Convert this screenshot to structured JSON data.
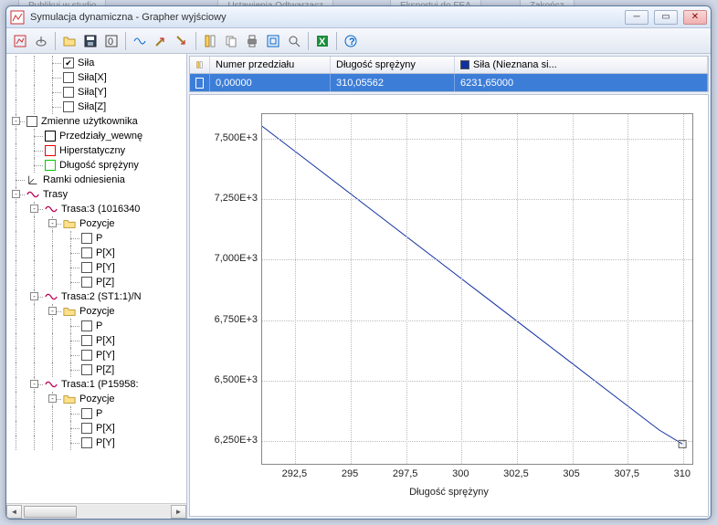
{
  "bg_tabs": [
    "Publikuj w studio",
    "Ustawienia Odtwarzacz",
    "Eksportuj do FEA",
    "Zakończ"
  ],
  "window": {
    "title": "Symulacja dynamiczna - Grapher wyjściowy"
  },
  "tree": {
    "items": [
      {
        "depth": 3,
        "check": "checked",
        "label": "Siła"
      },
      {
        "depth": 3,
        "check": "unchecked",
        "label": "Siła[X]"
      },
      {
        "depth": 3,
        "check": "unchecked",
        "label": "Siła[Y]"
      },
      {
        "depth": 3,
        "check": "unchecked",
        "label": "Siła[Z]"
      },
      {
        "depth": 1,
        "expander": "-",
        "check": "unchecked",
        "label": "Zmienne użytkownika"
      },
      {
        "depth": 2,
        "check": "unchecked",
        "color": "#000",
        "label": "Przedziały_wewnę"
      },
      {
        "depth": 2,
        "check": "unchecked",
        "color": "#e00",
        "label": "Hiperstatyczny"
      },
      {
        "depth": 2,
        "check": "unchecked",
        "color": "#0c0",
        "label": "Długość sprężyny"
      },
      {
        "depth": 1,
        "icon": "axes",
        "label": "Ramki odniesienia"
      },
      {
        "depth": 1,
        "expander": "-",
        "icon": "wave",
        "label": "Trasy"
      },
      {
        "depth": 2,
        "expander": "-",
        "icon": "wave",
        "label": "Trasa:3 (1016340"
      },
      {
        "depth": 3,
        "expander": "-",
        "icon": "folder",
        "label": "Pozycje"
      },
      {
        "depth": 4,
        "check": "unchecked",
        "label": "P"
      },
      {
        "depth": 4,
        "check": "unchecked",
        "label": "P[X]"
      },
      {
        "depth": 4,
        "check": "unchecked",
        "label": "P[Y]"
      },
      {
        "depth": 4,
        "check": "unchecked",
        "label": "P[Z]"
      },
      {
        "depth": 2,
        "expander": "-",
        "icon": "wave",
        "label": "Trasa:2 (ST1:1)/N"
      },
      {
        "depth": 3,
        "expander": "-",
        "icon": "folder",
        "label": "Pozycje"
      },
      {
        "depth": 4,
        "check": "unchecked",
        "label": "P"
      },
      {
        "depth": 4,
        "check": "unchecked",
        "label": "P[X]"
      },
      {
        "depth": 4,
        "check": "unchecked",
        "label": "P[Y]"
      },
      {
        "depth": 4,
        "check": "unchecked",
        "label": "P[Z]"
      },
      {
        "depth": 2,
        "expander": "-",
        "icon": "wave",
        "label": "Trasa:1 (P15958:"
      },
      {
        "depth": 3,
        "expander": "-",
        "icon": "folder",
        "label": "Pozycje"
      },
      {
        "depth": 4,
        "check": "unchecked",
        "label": "P"
      },
      {
        "depth": 4,
        "check": "unchecked",
        "label": "P[X]"
      },
      {
        "depth": 4,
        "check": "unchecked",
        "label": "P[Y]"
      }
    ]
  },
  "grid": {
    "headers": {
      "col1": "Numer przedziału",
      "col2": "Długość sprężyny",
      "col3": "Siła (Nieznana si..."
    },
    "row": {
      "col1": "0,00000",
      "col2": "310,05562",
      "col3": "6231,65000"
    },
    "swatch_color": "#1030a0"
  },
  "chart_data": {
    "type": "line",
    "xlabel": "Długość sprężyny",
    "ylabel": "",
    "x_ticks": [
      292.5,
      295,
      297.5,
      300,
      302.5,
      305,
      307.5,
      310
    ],
    "x_tick_labels": [
      "292,5",
      "295",
      "297,5",
      "300",
      "302,5",
      "305",
      "307,5",
      "310"
    ],
    "y_ticks": [
      6250,
      6500,
      6750,
      7000,
      7250,
      7500
    ],
    "y_tick_labels": [
      "6,250E+3",
      "6,500E+3",
      "6,750E+3",
      "7,000E+3",
      "7,250E+3",
      "7,500E+3"
    ],
    "xlim": [
      291,
      310.5
    ],
    "ylim": [
      6150,
      7600
    ],
    "series": [
      {
        "name": "Siła",
        "x": [
          291.0,
          293.0,
          295.0,
          297.0,
          299.0,
          301.0,
          303.0,
          305.0,
          307.0,
          309.0,
          310.05
        ],
        "y": [
          7550,
          7410,
          7270,
          7130,
          6990,
          6850,
          6710,
          6570,
          6430,
          6290,
          6232
        ]
      }
    ]
  }
}
